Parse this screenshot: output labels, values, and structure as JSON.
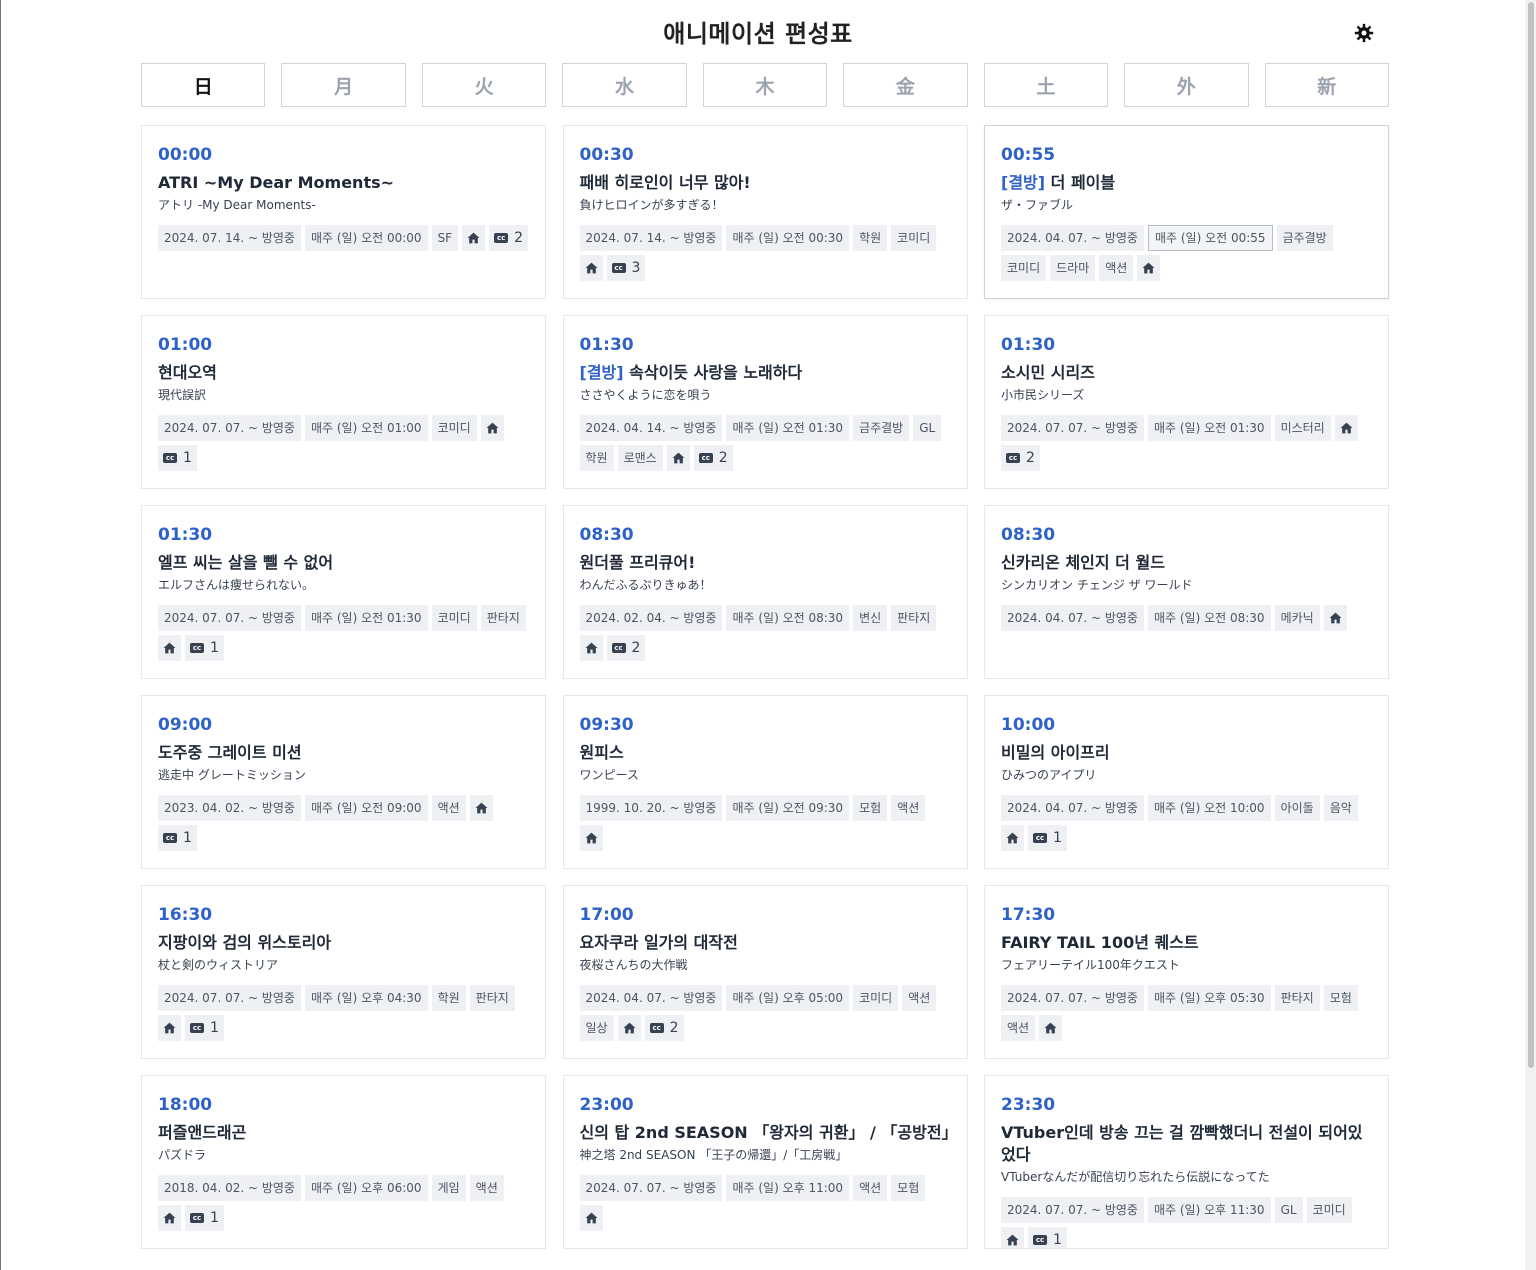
{
  "header": {
    "title": "애니메이션 편성표",
    "theme_icon": "gear-icon"
  },
  "tabs": [
    {
      "label": "日",
      "active": true
    },
    {
      "label": "月",
      "active": false
    },
    {
      "label": "火",
      "active": false
    },
    {
      "label": "水",
      "active": false
    },
    {
      "label": "木",
      "active": false
    },
    {
      "label": "金",
      "active": false
    },
    {
      "label": "土",
      "active": false
    },
    {
      "label": "外",
      "active": false
    },
    {
      "label": "新",
      "active": false
    }
  ],
  "cards": [
    {
      "time": "00:00",
      "prefix": "",
      "title": "ATRI ~My Dear Moments~",
      "jp": "アトリ -My Dear Moments-",
      "tags": [
        "2024. 07. 14. ~ 방영중",
        "매주 (일) 오전 00:00",
        "SF",
        "#home",
        "#cc:2"
      ]
    },
    {
      "time": "00:30",
      "prefix": "",
      "title": "패배 히로인이 너무 많아!",
      "jp": "負けヒロインが多すぎる！",
      "tags": [
        "2024. 07. 14. ~ 방영중",
        "매주 (일) 오전 00:30",
        "학원",
        "코미디",
        "#home",
        "#cc:3"
      ]
    },
    {
      "time": "00:55",
      "prefix": "결방",
      "title": " 더 페이블",
      "jp": "ザ・ファブル",
      "highlight": true,
      "tags": [
        "2024. 04. 07. ~ 방영중",
        "!매주 (일) 오전 00:55",
        "금주결방",
        "코미디",
        "드라마",
        "액션",
        "#home"
      ]
    },
    {
      "time": "01:00",
      "prefix": "",
      "title": "현대오역",
      "jp": "現代誤訳",
      "tags": [
        "2024. 07. 07. ~ 방영중",
        "매주 (일) 오전 01:00",
        "코미디",
        "#home",
        "#cc:1"
      ]
    },
    {
      "time": "01:30",
      "prefix": "결방",
      "title": " 속삭이듯 사랑을 노래하다",
      "jp": "ささやくように恋を唄う",
      "tags": [
        "2024. 04. 14. ~ 방영중",
        "매주 (일) 오전 01:30",
        "금주결방",
        "GL",
        "학원",
        "로맨스",
        "#home",
        "#cc:2"
      ]
    },
    {
      "time": "01:30",
      "prefix": "",
      "title": "소시민 시리즈",
      "jp": "小市民シリーズ",
      "tags": [
        "2024. 07. 07. ~ 방영중",
        "매주 (일) 오전 01:30",
        "미스터리",
        "#home",
        "#cc:2"
      ]
    },
    {
      "time": "01:30",
      "prefix": "",
      "title": "엘프 씨는 살을 뺄 수 없어",
      "jp": "エルフさんは痩せられない。",
      "tags": [
        "2024. 07. 07. ~ 방영중",
        "매주 (일) 오전 01:30",
        "코미디",
        "판타지",
        "#home",
        "#cc:1"
      ]
    },
    {
      "time": "08:30",
      "prefix": "",
      "title": "원더풀 프리큐어!",
      "jp": "わんだふるぷりきゅあ！",
      "tags": [
        "2024. 02. 04. ~ 방영중",
        "매주 (일) 오전 08:30",
        "변신",
        "판타지",
        "#home",
        "#cc:2"
      ]
    },
    {
      "time": "08:30",
      "prefix": "",
      "title": "신카리온 체인지 더 월드",
      "jp": "シンカリオン チェンジ ザ ワールド",
      "tags": [
        "2024. 04. 07. ~ 방영중",
        "매주 (일) 오전 08:30",
        "메카닉",
        "#home"
      ]
    },
    {
      "time": "09:00",
      "prefix": "",
      "title": "도주중 그레이트 미션",
      "jp": "逃走中 グレートミッション",
      "tags": [
        "2023. 04. 02. ~ 방영중",
        "매주 (일) 오전 09:00",
        "액션",
        "#home",
        "#cc:1"
      ]
    },
    {
      "time": "09:30",
      "prefix": "",
      "title": "원피스",
      "jp": "ワンピース",
      "tags": [
        "1999. 10. 20. ~ 방영중",
        "매주 (일) 오전 09:30",
        "모험",
        "액션",
        "#home"
      ]
    },
    {
      "time": "10:00",
      "prefix": "",
      "title": "비밀의 아이프리",
      "jp": "ひみつのアイプリ",
      "tags": [
        "2024. 04. 07. ~ 방영중",
        "매주 (일) 오전 10:00",
        "아이돌",
        "음악",
        "#home",
        "#cc:1"
      ]
    },
    {
      "time": "16:30",
      "prefix": "",
      "title": "지팡이와 검의 위스토리아",
      "jp": "杖と剣のウィストリア",
      "tags": [
        "2024. 07. 07. ~ 방영중",
        "매주 (일) 오후 04:30",
        "학원",
        "판타지",
        "#home",
        "#cc:1"
      ]
    },
    {
      "time": "17:00",
      "prefix": "",
      "title": "요자쿠라 일가의 대작전",
      "jp": "夜桜さんちの大作戦",
      "tags": [
        "2024. 04. 07. ~ 방영중",
        "매주 (일) 오후 05:00",
        "코미디",
        "액션",
        "일상",
        "#home",
        "#cc:2"
      ]
    },
    {
      "time": "17:30",
      "prefix": "",
      "title": "FAIRY TAIL 100년 퀘스트",
      "jp": "フェアリーテイル100年クエスト",
      "tags": [
        "2024. 07. 07. ~ 방영중",
        "매주 (일) 오후 05:30",
        "판타지",
        "모험",
        "액션",
        "#home"
      ]
    },
    {
      "time": "18:00",
      "prefix": "",
      "title": "퍼즐앤드래곤",
      "jp": "パズドラ",
      "tags": [
        "2018. 04. 02. ~ 방영중",
        "매주 (일) 오후 06:00",
        "게임",
        "액션",
        "#home",
        "#cc:1"
      ]
    },
    {
      "time": "23:00",
      "prefix": "",
      "title": "신의 탑 2nd SEASON 「왕자의 귀환」 / 「공방전」",
      "jp": "神之塔 2nd SEASON 「王子の帰還」/「工房戦」",
      "tags": [
        "2024. 07. 07. ~ 방영중",
        "매주 (일) 오후 11:00",
        "액션",
        "모험",
        "#home"
      ]
    },
    {
      "time": "23:30",
      "prefix": "",
      "title": "VTuber인데 방송 끄는 걸 깜빡했더니 전설이 되어있었다",
      "jp": "VTuberなんだが配信切り忘れたら伝説になってた",
      "tags": [
        "2024. 07. 07. ~ 방영중",
        "매주 (일) 오후 11:30",
        "GL",
        "코미디",
        "#home",
        "#cc:1"
      ]
    }
  ]
}
